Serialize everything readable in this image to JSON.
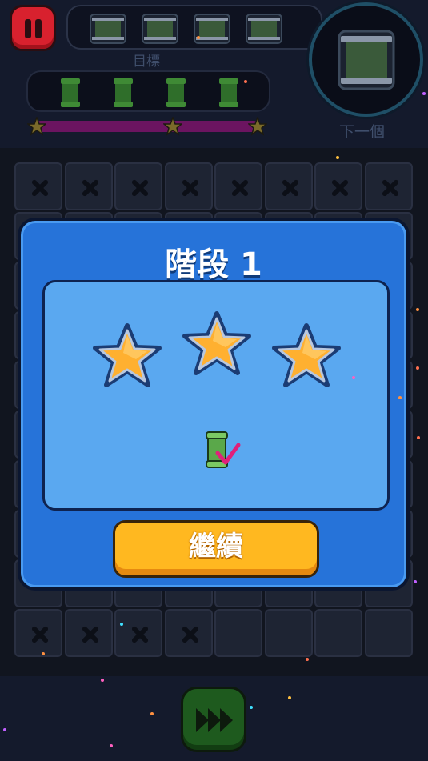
{
  "hud": {
    "goal_label": "目標",
    "next_label": "下一個",
    "queue_pipes": [
      "pipe",
      "pipe",
      "pipe",
      "pipe"
    ],
    "goal_pipes": [
      "green-pipe",
      "green-pipe",
      "green-pipe",
      "green-pipe"
    ],
    "progress_fraction": 1.0,
    "progress_stars": 3
  },
  "board": {
    "cols": 8,
    "rows": 10,
    "blocked_rows": [
      0,
      9
    ]
  },
  "dialog": {
    "title": "階段 1",
    "stars_earned": 3,
    "result_icon": "green-pipe-check",
    "continue_label": "繼續"
  },
  "colors": {
    "dialog_blue": "#2673d9",
    "inner_blue": "#5aa8f0",
    "star_gold": "#ffb030",
    "button_orange": "#ffb820",
    "pause_red": "#d8212e",
    "check_pink": "#e0207a"
  },
  "icons": {
    "pause": "pause-icon",
    "fast_forward": "fast-forward-icon",
    "blocked_cell": "x-icon",
    "star": "star-icon"
  }
}
